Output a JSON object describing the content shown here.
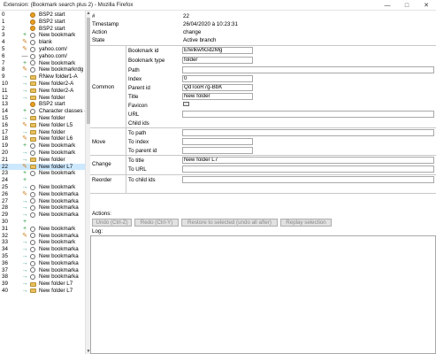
{
  "window": {
    "title": "Extension: (Bookmark search plus 2) - Mozilla Firefox",
    "controls": [
      "—",
      "□",
      "✕"
    ]
  },
  "history": [
    {
      "n": "0",
      "action": "",
      "icon": "bsp2",
      "label": "BSP2 start",
      "selected": false
    },
    {
      "n": "1",
      "action": "",
      "icon": "bsp2",
      "label": "BSP2 start",
      "selected": false
    },
    {
      "n": "2",
      "action": "",
      "icon": "bsp2",
      "label": "BSP2 start",
      "selected": false
    },
    {
      "n": "3",
      "action": "create",
      "icon": "globe",
      "label": "New bookmark",
      "selected": false
    },
    {
      "n": "4",
      "action": "edit",
      "icon": "globe",
      "label": "blank",
      "selected": false
    },
    {
      "n": "5",
      "action": "edit",
      "icon": "globe",
      "label": "yahoo.com/",
      "selected": false
    },
    {
      "n": "6",
      "action": "remove",
      "icon": "globe",
      "label": "yahoo.com/",
      "selected": false
    },
    {
      "n": "7",
      "action": "create",
      "icon": "globe",
      "label": "New bookmark",
      "selected": false
    },
    {
      "n": "8",
      "action": "edit",
      "icon": "globe",
      "label": "New bookmarkrdg",
      "selected": false
    },
    {
      "n": "9",
      "action": "move",
      "icon": "folder",
      "label": "RNew folder1-A",
      "selected": false
    },
    {
      "n": "10",
      "action": "move",
      "icon": "folder",
      "label": "New folder2-A",
      "selected": false
    },
    {
      "n": "11",
      "action": "move",
      "icon": "folder",
      "label": "New folder2-A",
      "selected": false
    },
    {
      "n": "12",
      "action": "move",
      "icon": "folder",
      "label": "New folder",
      "selected": false
    },
    {
      "n": "13",
      "action": "",
      "icon": "bsp2",
      "label": "BSP2 start",
      "selected": false
    },
    {
      "n": "14",
      "action": "create",
      "icon": "globe",
      "label": "Character classes -",
      "selected": false
    },
    {
      "n": "15",
      "action": "move",
      "icon": "folder",
      "label": "New folder",
      "selected": false
    },
    {
      "n": "16",
      "action": "edit",
      "icon": "folder",
      "label": "New folder L5",
      "selected": false
    },
    {
      "n": "17",
      "action": "move",
      "icon": "folder",
      "label": "New folder",
      "selected": false
    },
    {
      "n": "18",
      "action": "edit",
      "icon": "folder",
      "label": "New folder L6",
      "selected": false
    },
    {
      "n": "19",
      "action": "create",
      "icon": "globe",
      "label": "New bookmark",
      "selected": false
    },
    {
      "n": "20",
      "action": "move",
      "icon": "globe",
      "label": "New bookmark",
      "selected": false
    },
    {
      "n": "21",
      "action": "move",
      "icon": "folder",
      "label": "New folder",
      "selected": false
    },
    {
      "n": "22",
      "action": "edit",
      "icon": "folder",
      "label": "New folder L7",
      "selected": true
    },
    {
      "n": "23",
      "action": "create",
      "icon": "globe",
      "label": "New bookmark",
      "selected": false
    },
    {
      "n": "24",
      "action": "create",
      "icon": "",
      "label": "",
      "selected": false
    },
    {
      "n": "25",
      "action": "move",
      "icon": "globe",
      "label": "New bookmark",
      "selected": false
    },
    {
      "n": "26",
      "action": "edit",
      "icon": "globe",
      "label": "New bookmarka",
      "selected": false
    },
    {
      "n": "27",
      "action": "move",
      "icon": "globe",
      "label": "New bookmarka",
      "selected": false
    },
    {
      "n": "28",
      "action": "move",
      "icon": "globe",
      "label": "New bookmarka",
      "selected": false
    },
    {
      "n": "29",
      "action": "move",
      "icon": "globe",
      "label": "New bookmarka",
      "selected": false
    },
    {
      "n": "30",
      "action": "create",
      "icon": "",
      "label": "",
      "selected": false
    },
    {
      "n": "31",
      "action": "create",
      "icon": "globe",
      "label": "New bookmark",
      "selected": false
    },
    {
      "n": "32",
      "action": "edit",
      "icon": "globe",
      "label": "New bookmarka",
      "selected": false
    },
    {
      "n": "33",
      "action": "move",
      "icon": "globe",
      "label": "New bookmark",
      "selected": false
    },
    {
      "n": "34",
      "action": "move",
      "icon": "globe",
      "label": "New bookmarka",
      "selected": false
    },
    {
      "n": "35",
      "action": "move",
      "icon": "globe",
      "label": "New bookmarka",
      "selected": false
    },
    {
      "n": "36",
      "action": "move",
      "icon": "globe",
      "label": "New bookmarka",
      "selected": false
    },
    {
      "n": "37",
      "action": "move",
      "icon": "globe",
      "label": "New bookmarka",
      "selected": false
    },
    {
      "n": "38",
      "action": "move",
      "icon": "globe",
      "label": "New bookmarka",
      "selected": false
    },
    {
      "n": "39",
      "action": "move",
      "icon": "folder",
      "label": "New folder L7",
      "selected": false
    },
    {
      "n": "40",
      "action": "move",
      "icon": "folder",
      "label": "New folder L7",
      "selected": false
    }
  ],
  "details": {
    "hash_label": "#",
    "hash_value": "22",
    "timestamp_label": "Timestamp",
    "timestamp_value": "26/04/2020 à 10:23:31",
    "action_label": "Action",
    "action_value": "change",
    "state_label": "State",
    "state_value": "Active branch",
    "common": {
      "group_label": "Common",
      "bookmark_id_label": "Bookmark id",
      "bookmark_id_value": "EfwIkwhGd2Mg",
      "bookmark_type_label": "Bookmark type",
      "bookmark_type_value": "folder",
      "path_label": "Path",
      "path_value": "",
      "index_label": "Index",
      "index_value": "0",
      "parent_id_label": "Parent id",
      "parent_id_value": "QdTooR7g-BbK",
      "title_label": "Title",
      "title_value": "New folder",
      "favicon_label": "Favicon",
      "url_label": "URL",
      "url_value": "",
      "child_ids_label": "Child ids"
    },
    "move": {
      "group_label": "Move",
      "to_path_label": "To path",
      "to_path_value": "",
      "to_index_label": "To index",
      "to_index_value": "",
      "to_parent_id_label": "To parent id",
      "to_parent_id_value": ""
    },
    "change": {
      "group_label": "Change",
      "to_title_label": "To title",
      "to_title_value": "New folder L7",
      "to_url_label": "To URL",
      "to_url_value": ""
    },
    "reorder": {
      "group_label": "Reorder",
      "to_child_ids_label": "To child ids",
      "to_child_ids_value": ""
    }
  },
  "actions": {
    "label": "Actions:",
    "undo": "Undo (Ctrl-Z)",
    "redo": "Redo (Ctrl-Y)",
    "restore": "Restore to selected (undo all after)",
    "replay": "Replay selection"
  },
  "log": {
    "label": "Log:"
  },
  "colors": {
    "create": "#2a9a3a",
    "edit": "#d08020",
    "move": "#2a9a8a",
    "remove": "#555555",
    "bsp2": "#e8a020",
    "globe": "#6a6a6a",
    "folder": "#e8c060",
    "selected_bg": "#cce8ff"
  }
}
